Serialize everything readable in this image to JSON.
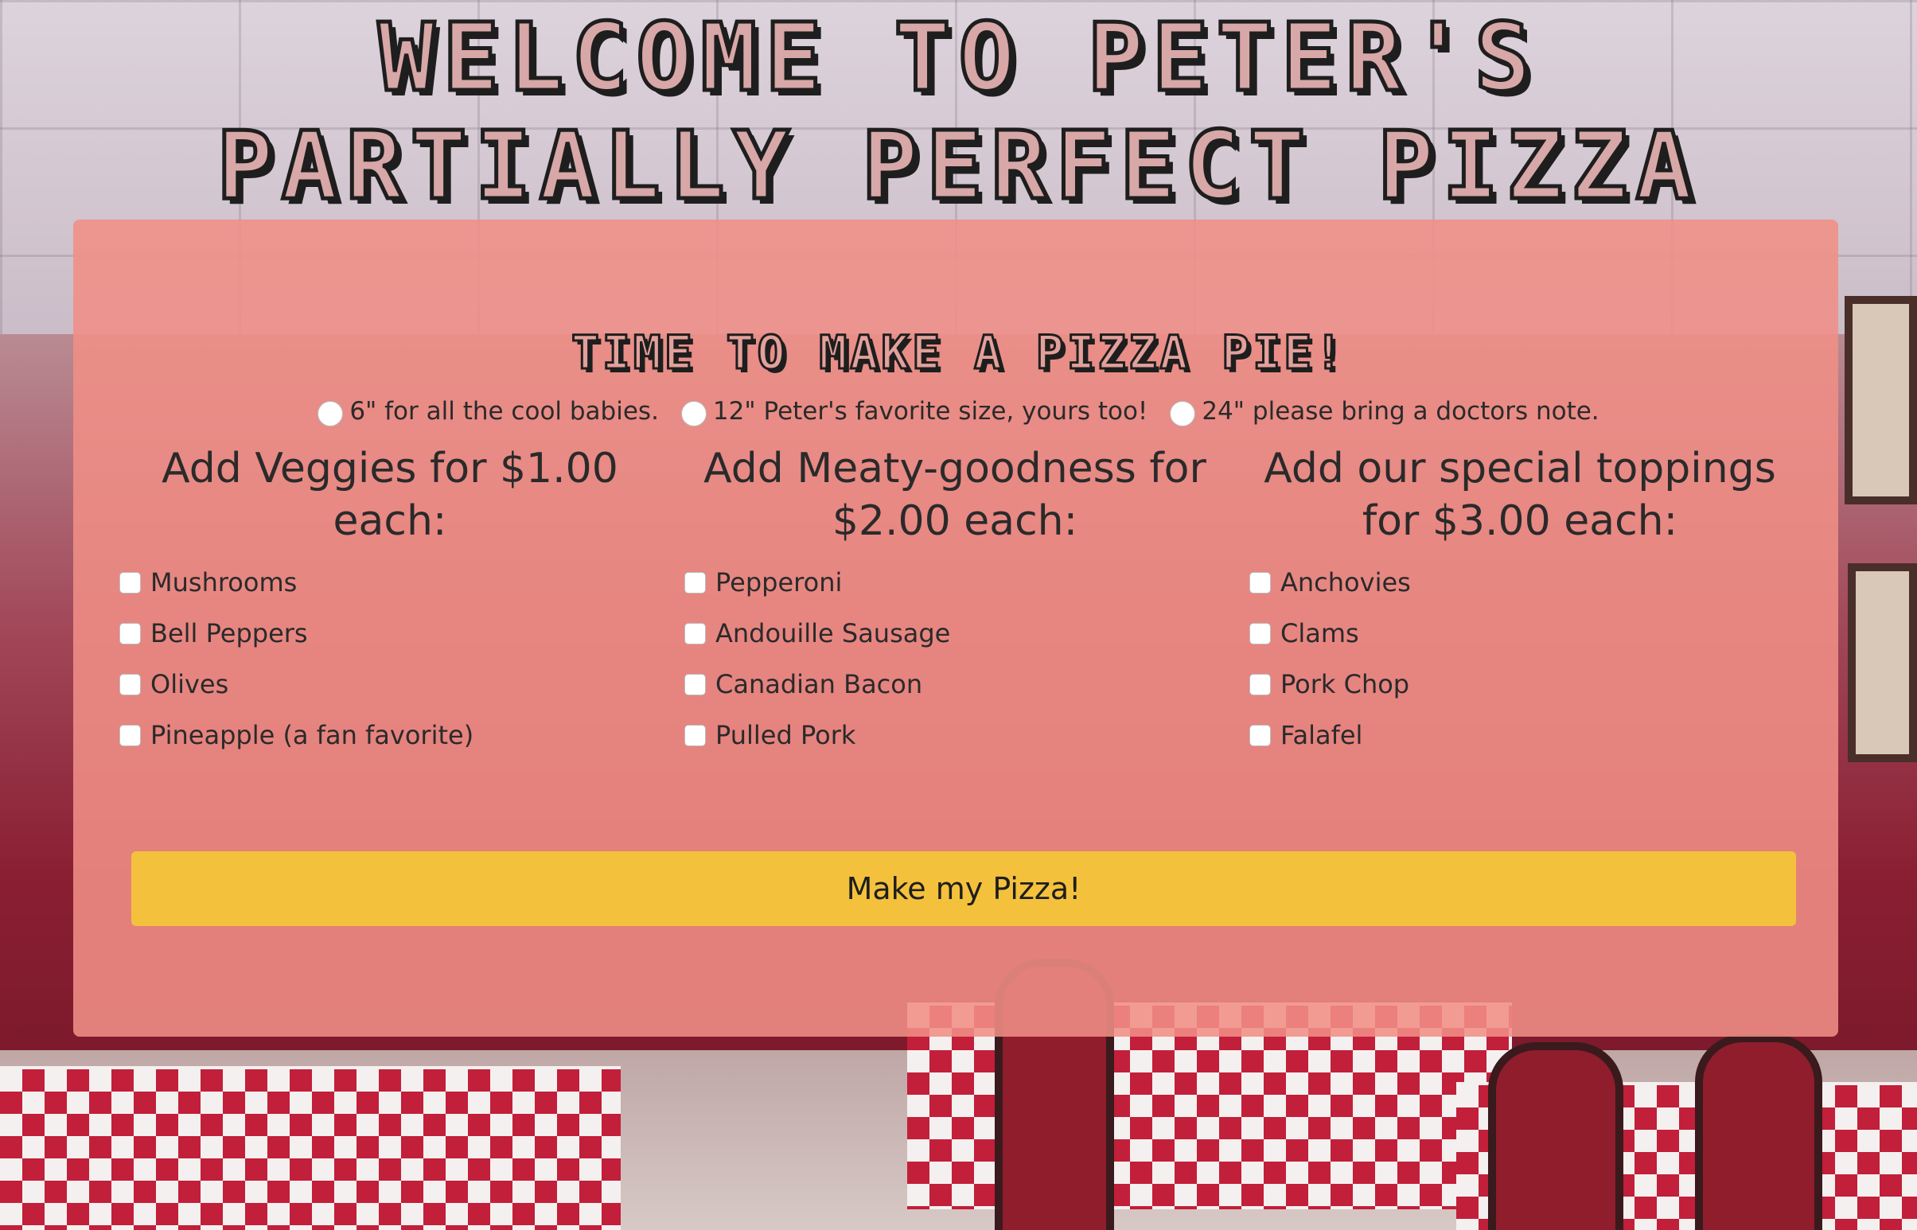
{
  "header": {
    "title_line1": "WELCOME TO PETER'S",
    "title_line2": "PARTIALLY PERFECT PIZZA"
  },
  "form": {
    "title": "TIME TO MAKE A PIZZA PIE!",
    "sizes": [
      {
        "label": "6\" for all the cool babies."
      },
      {
        "label": "12\" Peter's favorite size, yours too!"
      },
      {
        "label": "24\" please bring a doctors note."
      }
    ],
    "columns": [
      {
        "heading": "Add Veggies for $1.00 each:",
        "items": [
          "Mushrooms",
          "Bell Peppers",
          "Olives",
          "Pineapple (a fan favorite)"
        ]
      },
      {
        "heading": "Add Meaty-goodness for $2.00 each:",
        "items": [
          "Pepperoni",
          "Andouille Sausage",
          "Canadian Bacon",
          "Pulled Pork"
        ]
      },
      {
        "heading": "Add our special toppings for $3.00 each:",
        "items": [
          "Anchovies",
          "Clams",
          "Pork Chop",
          "Falafel"
        ]
      }
    ],
    "submit_label": "Make my Pizza!"
  },
  "colors": {
    "card": "#F08E86",
    "button": "#F4C13C",
    "title_fill": "#D8A7A7",
    "title_outline": "#1E1E1E"
  }
}
